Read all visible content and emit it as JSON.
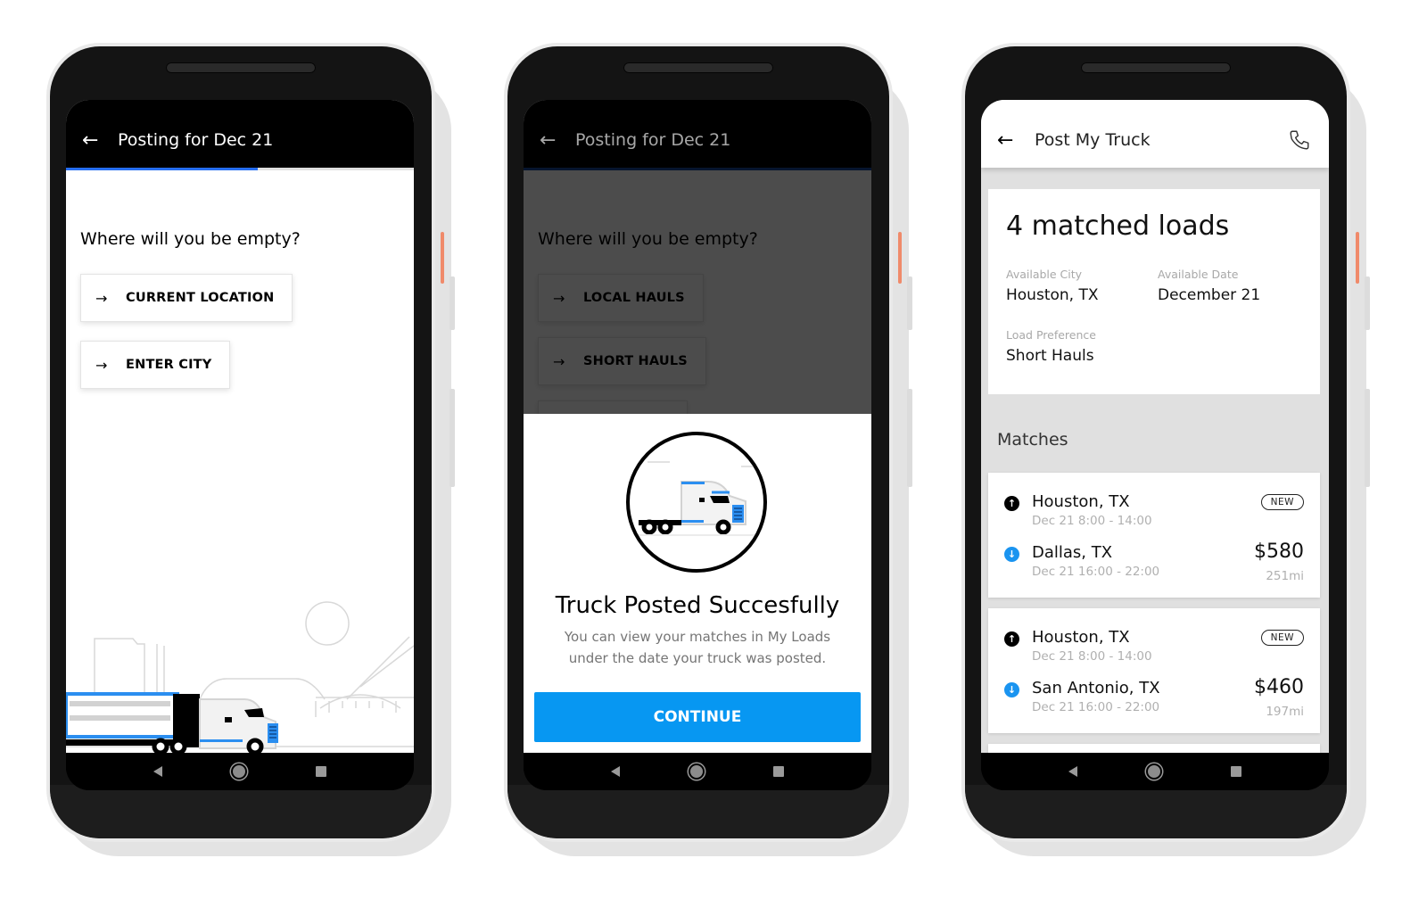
{
  "phones": [
    {
      "header": {
        "title": "Posting for Dec 21",
        "back_icon": "arrow-left-icon"
      },
      "progress": 0.55,
      "question": "Where will you be empty?",
      "options": [
        {
          "label": "CURRENT LOCATION",
          "icon": "arrow-right-icon"
        },
        {
          "label": "ENTER CITY",
          "icon": "arrow-right-icon"
        }
      ],
      "illustration": "truck-desert-scene"
    },
    {
      "header": {
        "title": "Posting for Dec 21",
        "back_icon": "arrow-left-icon"
      },
      "progress": 1.0,
      "question": "Where will you be empty?",
      "options": [
        {
          "label": "LOCAL HAULS",
          "icon": "arrow-right-icon"
        },
        {
          "label": "SHORT HAULS",
          "icon": "arrow-right-icon"
        }
      ],
      "dialog": {
        "illustration": "truck-cab-circle",
        "title": "Truck Posted Succesfully",
        "message": "You can view your matches in My Loads under the date your truck was posted.",
        "continue_label": "CONTINUE"
      }
    },
    {
      "header": {
        "title": "Post My Truck",
        "back_icon": "arrow-left-icon",
        "action_icon": "phone-icon"
      },
      "summary": {
        "title": "4 matched loads",
        "available_city_label": "Available City",
        "available_city": "Houston, TX",
        "available_date_label": "Available Date",
        "available_date": "December 21",
        "load_preference_label": "Load Preference",
        "load_preference": "Short Hauls"
      },
      "matches_label": "Matches",
      "matches": [
        {
          "badge": "NEW",
          "pickup_city": "Houston, TX",
          "pickup_time": "Dec 21 8:00 - 14:00",
          "dropoff_city": "Dallas, TX",
          "dropoff_time": "Dec 21 16:00 - 22:00",
          "price": "$580",
          "distance": "251mi"
        },
        {
          "badge": "NEW",
          "pickup_city": "Houston, TX",
          "pickup_time": "Dec 21 8:00 - 14:00",
          "dropoff_city": "San Antonio, TX",
          "dropoff_time": "Dec 21 16:00 - 22:00",
          "price": "$460",
          "distance": "197mi"
        }
      ]
    }
  ],
  "nav_bar": {
    "back": "nav-back-icon",
    "home": "nav-home-icon",
    "recents": "nav-recents-icon"
  },
  "colors": {
    "accent": "#276ef1",
    "cta": "#0797f2",
    "dropoff": "#1a94f0",
    "side_button": "#f08a6a"
  },
  "glyphs": {
    "back_arrow": "←",
    "right_arrow": "→",
    "up_arrow": "↑",
    "down_arrow": "↓"
  }
}
